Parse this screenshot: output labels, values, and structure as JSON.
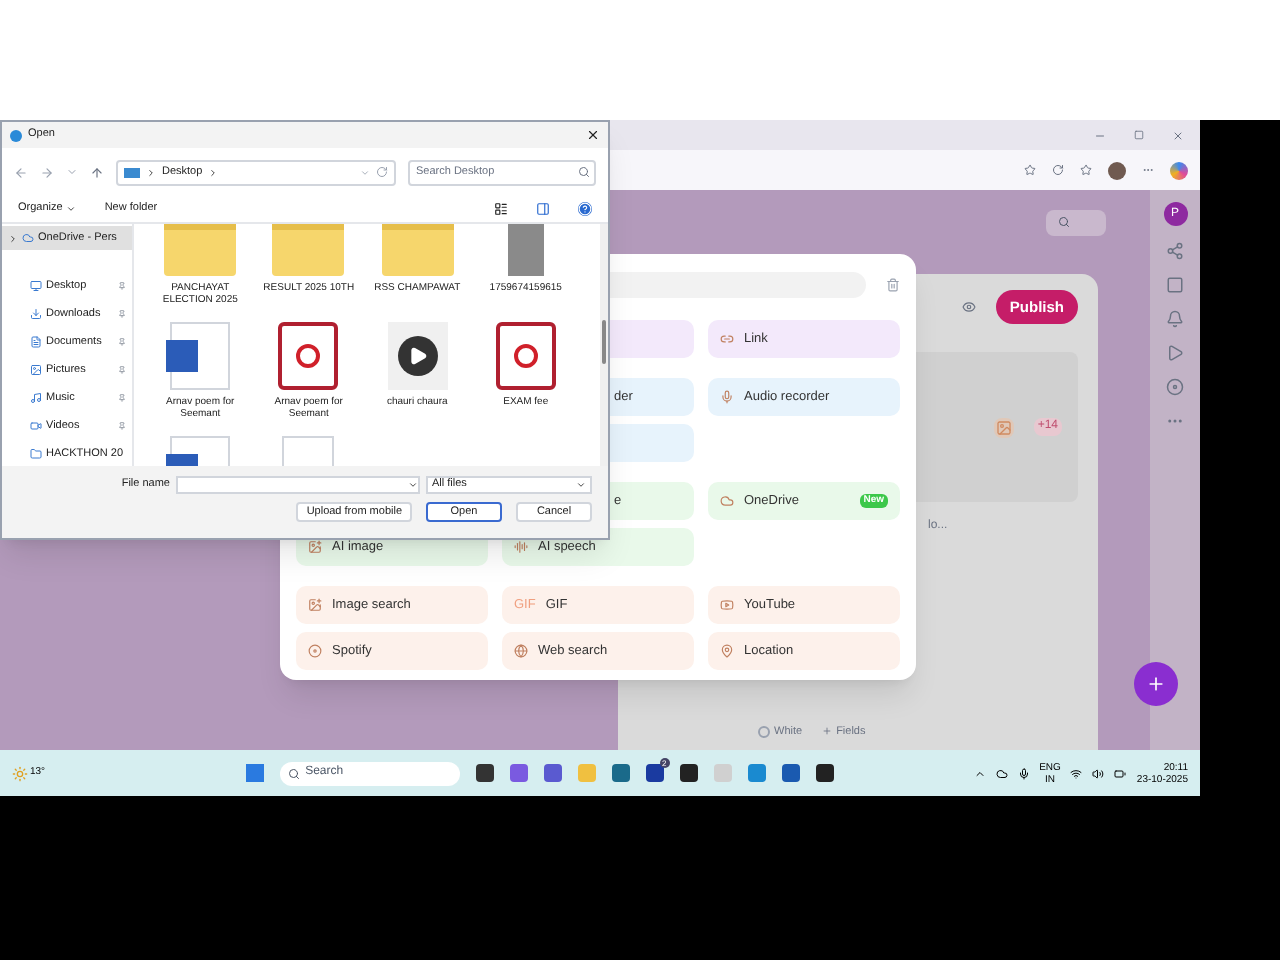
{
  "browser": {
    "publish": "Publish",
    "card_badge": "+14",
    "caption": "lo...",
    "color_option": "White",
    "fields_button": "Fields",
    "avatar_letter": "P"
  },
  "dialog": {
    "title": "Open",
    "path": "Desktop",
    "search_placeholder": "Search Desktop",
    "organize": "Organize",
    "new_folder": "New folder",
    "sidebar": [
      {
        "label": "OneDrive - Pers",
        "selected": true,
        "expandable": true,
        "pinned": false
      },
      {
        "label": "Desktop",
        "selected": false,
        "expandable": false,
        "pinned": true
      },
      {
        "label": "Downloads",
        "selected": false,
        "expandable": false,
        "pinned": true
      },
      {
        "label": "Documents",
        "selected": false,
        "expandable": false,
        "pinned": true
      },
      {
        "label": "Pictures",
        "selected": false,
        "expandable": false,
        "pinned": true
      },
      {
        "label": "Music",
        "selected": false,
        "expandable": false,
        "pinned": true
      },
      {
        "label": "Videos",
        "selected": false,
        "expandable": false,
        "pinned": true
      },
      {
        "label": "HACKTHON 20",
        "selected": false,
        "expandable": false,
        "pinned": false
      }
    ],
    "files": [
      {
        "kind": "folder",
        "name": "PANCHAYAT ELECTION 2025"
      },
      {
        "kind": "folder",
        "name": "RESULT 2025 10TH"
      },
      {
        "kind": "folder",
        "name": "RSS CHAMPAWAT"
      },
      {
        "kind": "image",
        "name": "1759674159615"
      },
      {
        "kind": "word",
        "name": "Arnav poem for Seemant"
      },
      {
        "kind": "pdf",
        "name": "Arnav poem for Seemant"
      },
      {
        "kind": "video",
        "name": "chauri chaura"
      },
      {
        "kind": "pdf",
        "name": "EXAM fee"
      },
      {
        "kind": "word"
      },
      {
        "kind": "blank"
      }
    ],
    "file_name_label": "File name",
    "file_type": "All files",
    "buttons": [
      "Upload from mobile",
      "Open",
      "Cancel"
    ]
  },
  "insert_panel": {
    "groups": [
      {
        "rows": [
          [
            {
              "kind": "gap"
            },
            {
              "kind": "tile",
              "color": "#f3e9fb"
            },
            {
              "kind": "tile",
              "color": "#f3e9fb",
              "label": "Link"
            }
          ]
        ]
      },
      {
        "rows": [
          [
            {
              "kind": "gap"
            },
            {
              "kind": "cut",
              "color": "#e7f3fc",
              "label": "der"
            },
            {
              "kind": "tile",
              "color": "#e7f3fc",
              "label": "Audio recorder"
            }
          ],
          [
            {
              "kind": "gap"
            },
            {
              "kind": "tile",
              "color": "#e7f3fc"
            },
            {
              "kind": "gap"
            }
          ]
        ]
      },
      {
        "rows": [
          [
            {
              "kind": "gap"
            },
            {
              "kind": "cut",
              "color": "#e9f9ea",
              "label": "e"
            },
            {
              "kind": "tile",
              "color": "#e9f9ea",
              "label": "OneDrive",
              "badge": "New"
            }
          ],
          [
            {
              "kind": "tile",
              "color": "#e9f9ea",
              "label": "AI image"
            },
            {
              "kind": "tile",
              "color": "#e9f9ea",
              "label": "AI speech"
            },
            {
              "kind": "gap"
            }
          ]
        ]
      },
      {
        "rows": [
          [
            {
              "kind": "tile",
              "color": "#fdf1eb",
              "label": "Image search"
            },
            {
              "kind": "tile",
              "color": "#fdf1eb",
              "label": "GIF",
              "icon_text": "GIF"
            },
            {
              "kind": "tile",
              "color": "#fdf1eb",
              "label": "YouTube"
            }
          ],
          [
            {
              "kind": "tile",
              "color": "#fdf1eb",
              "label": "Spotify"
            },
            {
              "kind": "tile",
              "color": "#fdf1eb",
              "label": "Web search"
            },
            {
              "kind": "tile",
              "color": "#fdf1eb",
              "label": "Location"
            }
          ]
        ]
      }
    ]
  },
  "taskbar": {
    "weather": "13°",
    "search_placeholder": "Search",
    "app_badge": "2",
    "language": "ENG",
    "region": "IN",
    "time": "20:11",
    "date": "23-10-2025"
  }
}
